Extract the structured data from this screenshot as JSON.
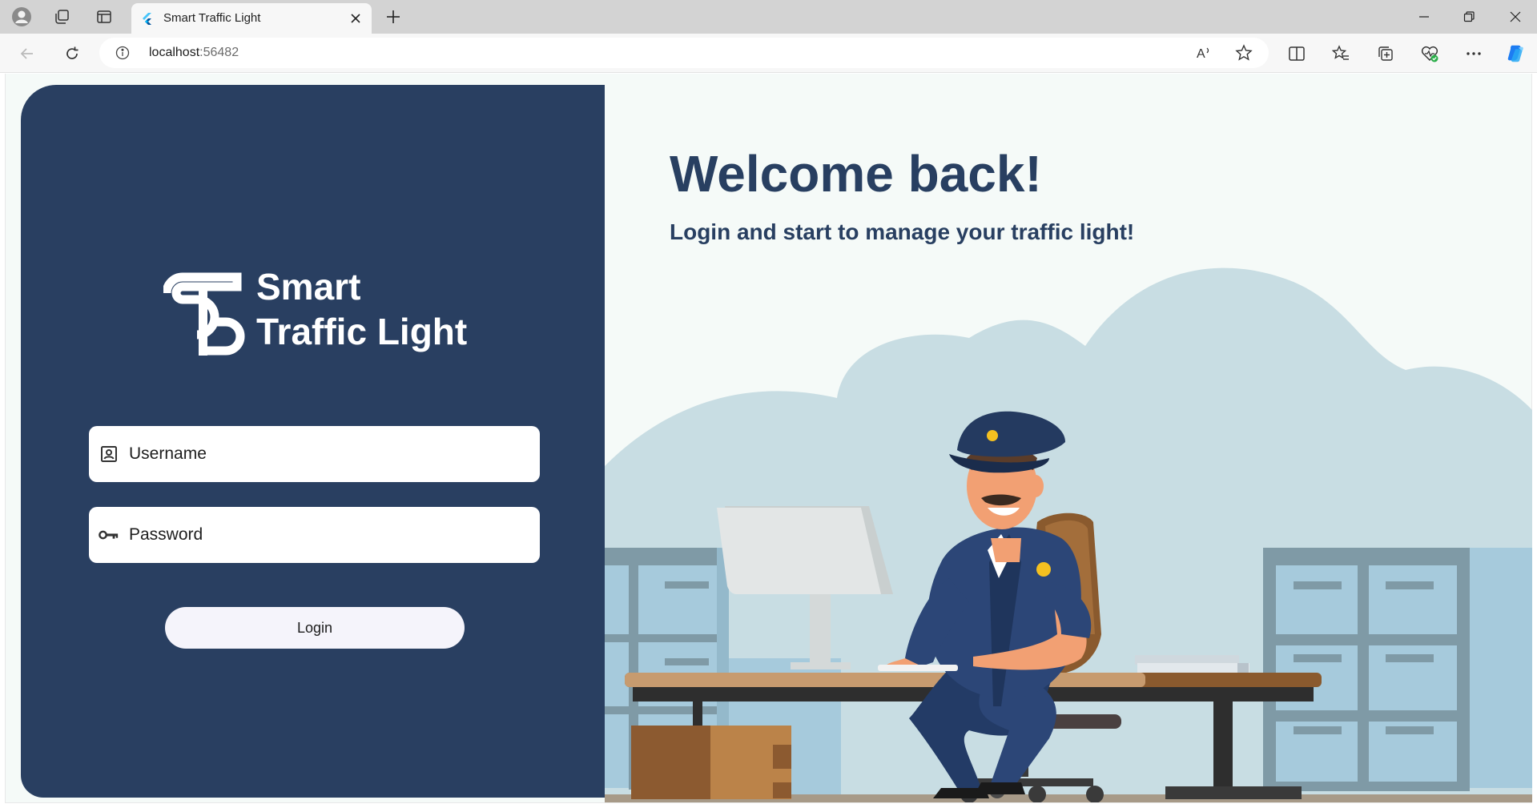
{
  "browser": {
    "tab_title": "Smart Traffic Light",
    "url_host": "localhost",
    "url_port": ":56482",
    "read_aloud_label": "A",
    "icons": [
      "profile-icon",
      "workspaces-icon",
      "tab-actions-icon",
      "flutter-favicon-icon",
      "close-tab-icon",
      "new-tab-icon",
      "minimize-icon",
      "restore-icon",
      "close-window-icon",
      "back-icon",
      "refresh-icon",
      "site-info-icon",
      "read-aloud-icon",
      "favorite-star-icon",
      "split-screen-icon",
      "favorites-icon",
      "collections-icon",
      "browser-essentials-icon",
      "more-icon",
      "copilot-icon"
    ]
  },
  "brand": {
    "line1": "Smart",
    "line2": "Traffic Light"
  },
  "login_form": {
    "username_placeholder": "Username",
    "password_placeholder": "Password",
    "login_button": "Login"
  },
  "hero": {
    "title": "Welcome back!",
    "subtitle": "Login and start to manage your traffic light!"
  },
  "colors": {
    "panel": "#293f61",
    "heading": "#283f61",
    "background": "#f5faf8",
    "button": "#f5f4fb"
  }
}
